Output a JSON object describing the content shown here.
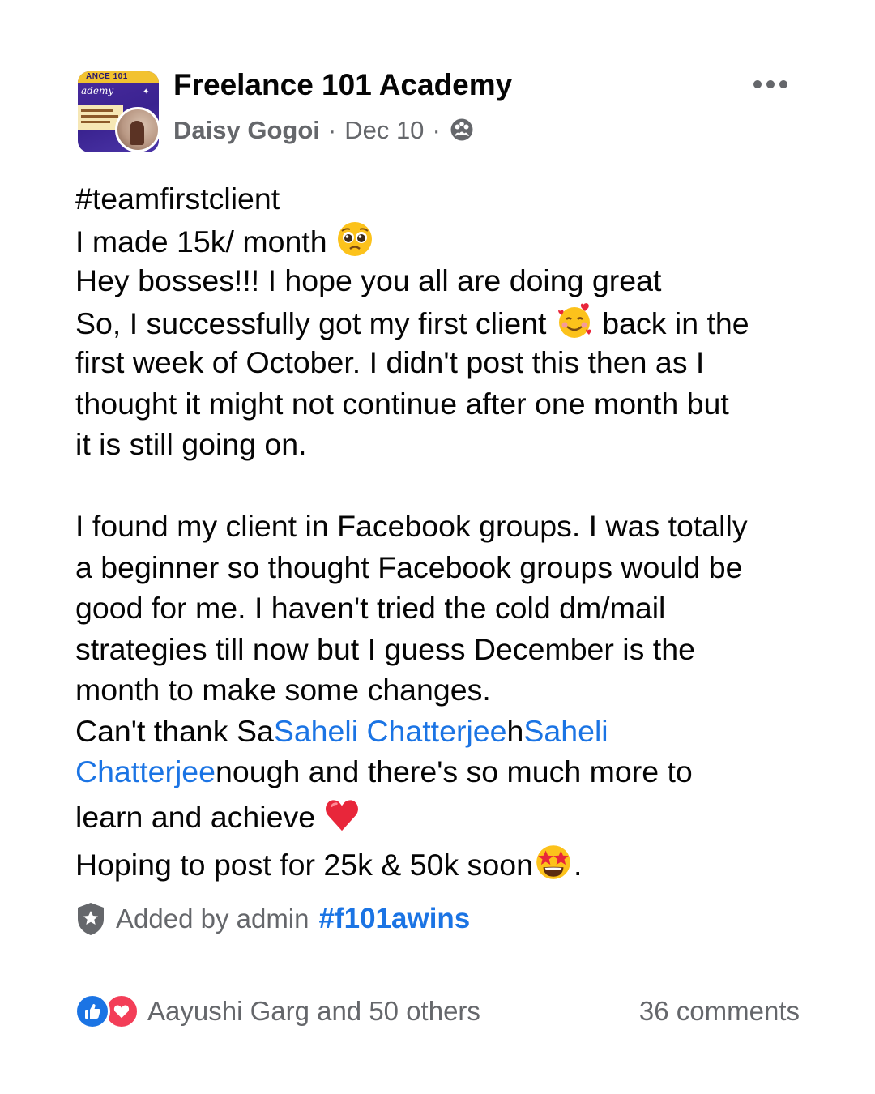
{
  "header": {
    "group_name": "Freelance 101 Academy",
    "author": "Daisy Gogoi",
    "separator": "·",
    "date": "Dec 10",
    "privacy_icon": "members-group-icon",
    "more_icon": "more-horizontal-icon",
    "avatar_text": {
      "band": "ANCE 101",
      "script": "ademy"
    }
  },
  "post": {
    "l1": "#teamfirstclient",
    "l2": "I made 15k/ month ",
    "l3": "Hey bosses!!! I hope you all are doing great",
    "l4a": "So, I successfully got my first client ",
    "l4b": " back in the",
    "l5": "first week of October. I didn't post this then as I",
    "l6": "thought it might not continue after one month but",
    "l7": "it is still going on.",
    "l8": "I found my client in Facebook groups. I was totally",
    "l9": "a beginner so thought Facebook groups would be",
    "l10": "good for me. I haven't tried the cold dm/mail",
    "l11": "strategies till now but I guess December is the",
    "l12": "month to make some changes.",
    "l13a": "Can't thank Sa",
    "l13b": "Saheli Chatterjee",
    "l13c": "h",
    "l13d": "Saheli",
    "l14a": "Chatterjee",
    "l14b": "nough and there's so much more to",
    "l15": "learn and achieve ",
    "l16a": "Hoping to post for 25k & 50k soon",
    "l16b": ".",
    "emojis": [
      "pleading-face",
      "smiling-face-with-hearts",
      "red-heart",
      "star-struck"
    ]
  },
  "footer": {
    "admin_label": "Added by admin",
    "admin_tag": "#f101awins",
    "admin_icon": "admin-shield-icon",
    "reactions": [
      "like",
      "love"
    ],
    "reactions_text": "Aayushi Garg and 50 others",
    "comments": "36 comments"
  },
  "colors": {
    "text": "#050505",
    "secondary": "#65676b",
    "link": "#1b74e4",
    "like": "#1b74e4",
    "love": "#f33e58"
  }
}
